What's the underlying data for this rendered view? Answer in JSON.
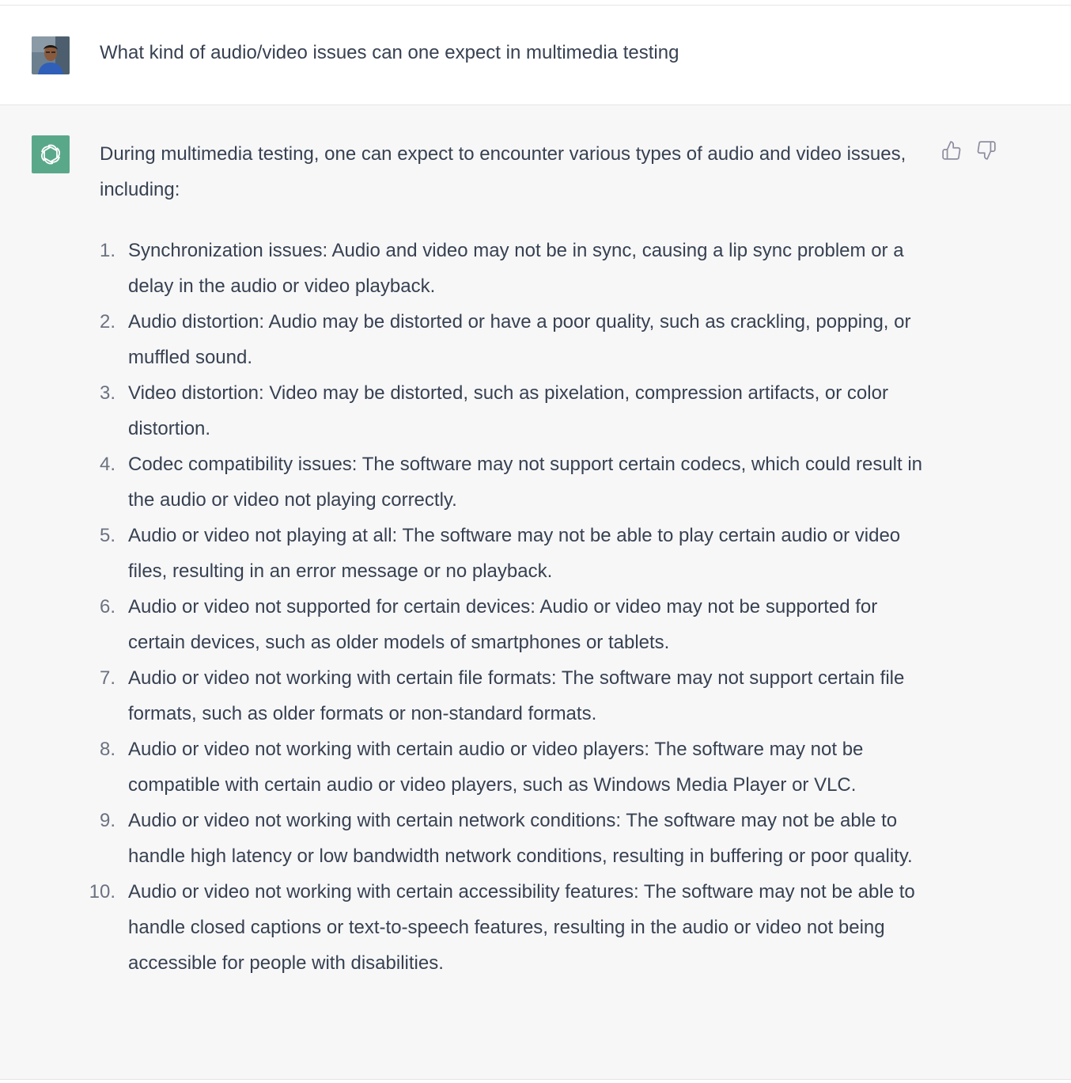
{
  "user": {
    "message": "What kind of audio/video issues can one expect in multimedia testing"
  },
  "assistant": {
    "intro": "During multimedia testing, one can expect to encounter various types of audio and video issues, including:",
    "items": [
      {
        "num": "1.",
        "text": "Synchronization issues: Audio and video may not be in sync, causing a lip sync problem or a delay in the audio or video playback."
      },
      {
        "num": "2.",
        "text": "Audio distortion: Audio may be distorted or have a poor quality, such as crackling, popping, or muffled sound."
      },
      {
        "num": "3.",
        "text": "Video distortion: Video may be distorted, such as pixelation, compression artifacts, or color distortion."
      },
      {
        "num": "4.",
        "text": "Codec compatibility issues: The software may not support certain codecs, which could result in the audio or video not playing correctly."
      },
      {
        "num": "5.",
        "text": "Audio or video not playing at all: The software may not be able to play certain audio or video files, resulting in an error message or no playback."
      },
      {
        "num": "6.",
        "text": "Audio or video not supported for certain devices: Audio or video may not be supported for certain devices, such as older models of smartphones or tablets."
      },
      {
        "num": "7.",
        "text": "Audio or video not working with certain file formats: The software may not support certain file formats, such as older formats or non-standard formats."
      },
      {
        "num": "8.",
        "text": "Audio or video not working with certain audio or video players: The software may not be compatible with certain audio or video players, such as Windows Media Player or VLC."
      },
      {
        "num": "9.",
        "text": "Audio or video not working with certain network conditions: The software may not be able to handle high latency or low bandwidth network conditions, resulting in buffering or poor quality."
      },
      {
        "num": "10.",
        "text": "Audio or video not working with certain accessibility features: The software may not be able to handle closed captions or text-to-speech features, resulting in the audio or video not being accessible for people with disabilities."
      }
    ]
  },
  "icons": {
    "user_avatar": "user-photo-avatar",
    "bot_avatar": "openai-logo-icon",
    "like": "thumbs-up-icon",
    "dislike": "thumbs-down-icon"
  },
  "colors": {
    "bot_avatar_bg": "#5aa88a",
    "assistant_bg": "#f7f7f8",
    "text": "#374151",
    "icon": "#8e8ea0"
  }
}
